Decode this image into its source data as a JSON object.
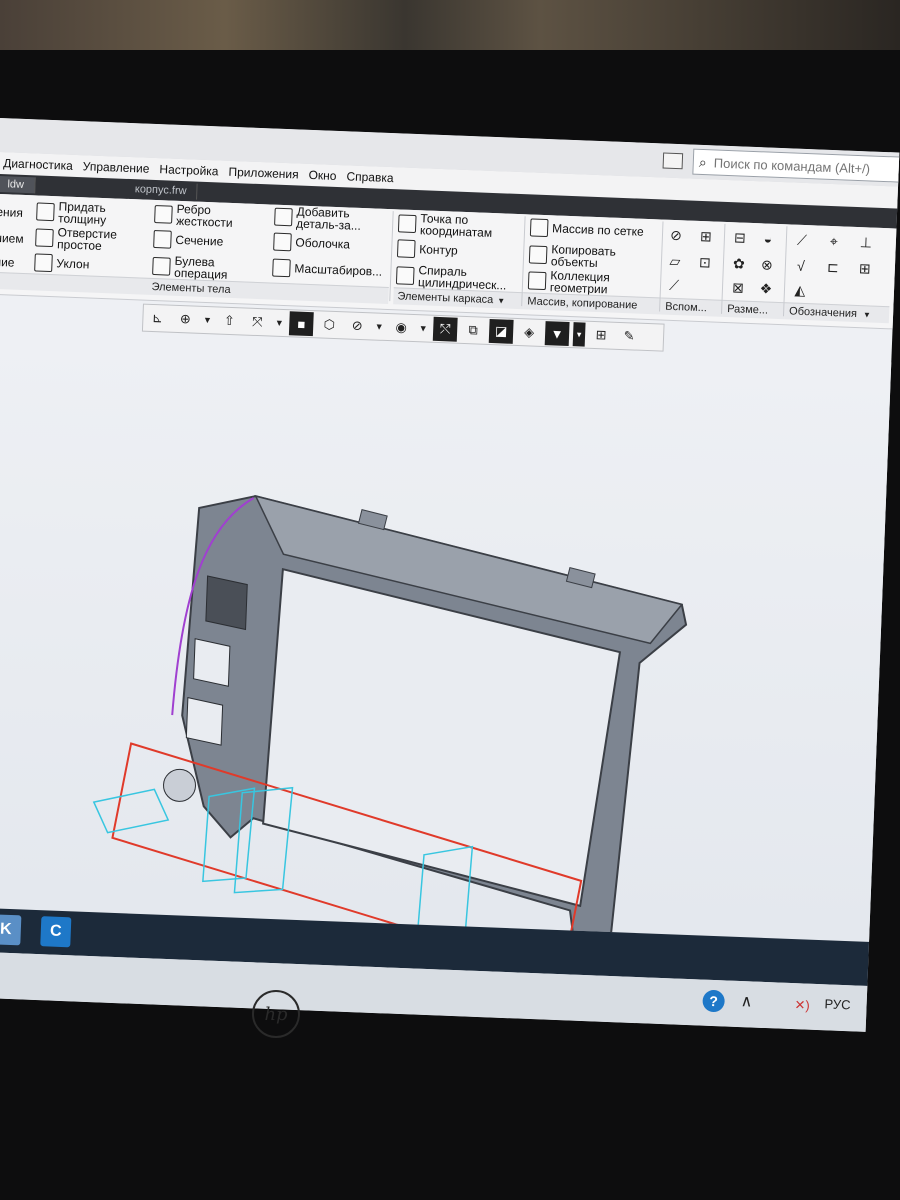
{
  "search": {
    "placeholder": "Поиск по командам (Alt+/)"
  },
  "menu": [
    "Диагностика",
    "Управление",
    "Настройка",
    "Приложения",
    "Окно",
    "Справка"
  ],
  "tabs": [
    "ldw",
    "корпус.frw"
  ],
  "ribbon": {
    "body": {
      "col1": [
        "ения",
        "нием",
        "ние"
      ],
      "col2": [
        "Придать толщину",
        "Отверстие простое",
        "Уклон"
      ],
      "col3": [
        "Ребро жесткости",
        "Сечение",
        "Булева операция"
      ],
      "col4": [
        "Добавить деталь-за...",
        "Оболочка",
        "Масштабиров..."
      ],
      "group": "Элементы тела"
    },
    "frame": {
      "items": [
        "Точка по координатам",
        "Контур",
        "Спираль цилиндрическ..."
      ],
      "group": "Элементы каркаса"
    },
    "array": {
      "items": [
        "Массив по сетке",
        "Копировать объекты",
        "Коллекция геометрии"
      ],
      "group": "Массив, копирование"
    },
    "groups_right": [
      "Вспом...",
      "Разме...",
      "Обозначения"
    ]
  },
  "tray": {
    "lang": "РУС",
    "help": "?"
  },
  "logo": "hp"
}
